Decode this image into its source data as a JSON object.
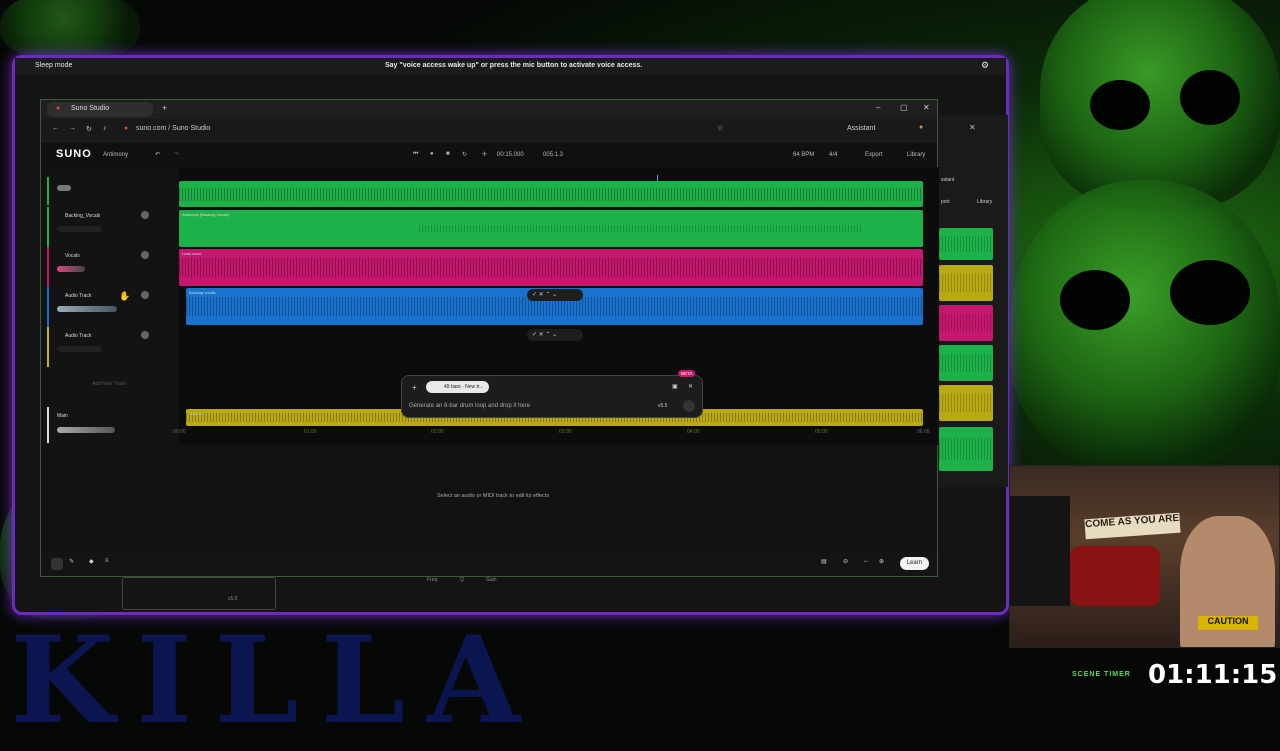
{
  "overlay": {
    "sleep_mode": "Sleep mode",
    "voice_hint": "Say \"voice access wake up\" or press the mic button to activate voice access.",
    "background_text": "KILLA",
    "scene_timer_label": "SCENE TIMER",
    "scene_timer_value": "01:11:15"
  },
  "browser": {
    "tab_title": "Suno Studio",
    "url": "suno.com / Suno Studio",
    "assistant_label": "Assistant"
  },
  "app": {
    "logo": "SUNO",
    "project_name": "Antimony",
    "time": "00:15.000",
    "position": "005.1.3",
    "bpm": "64 BPM",
    "time_signature": "4/4",
    "export_label": "Export",
    "library_label": "Library"
  },
  "tracks": [
    {
      "name": "",
      "color": "#1fb14a"
    },
    {
      "name": "Backing_Vocals",
      "color": "#1fb14a"
    },
    {
      "name": "Vocals",
      "color": "#c0186b"
    },
    {
      "name": "Audio Track",
      "color": "#1f6fc8"
    },
    {
      "name": "Audio Track",
      "color": "#c2b41a"
    }
  ],
  "add_track_label": "Add New Track",
  "main_label": "Main",
  "clips": [
    {
      "label": "",
      "color": "#1db149"
    },
    {
      "label": "Antimony (Backing Vocals)",
      "color": "#1db149"
    },
    {
      "label": "Lead vocal",
      "color": "#c5176d"
    },
    {
      "label": "Backing vocals",
      "color": "#1a72cf"
    },
    {
      "label": "Chorus",
      "color": "#b9aa14"
    }
  ],
  "prompt": {
    "chip_label": "49 bars · New tr...",
    "placeholder": "Generate an 8-bar drum loop and drop it here",
    "version": "v5.5",
    "beta_badge": "BETA"
  },
  "ruler_ticks": [
    "00:00",
    "01:00",
    "02:00",
    "03:00",
    "04:00",
    "05:00",
    "06:08"
  ],
  "effects_hint": "Select an audio or MIDI track to edit its effects",
  "learn_label": "Learn",
  "background_window": {
    "export": "port",
    "library": "Library",
    "assistant": "sstant",
    "eq_labels": [
      "Freq",
      "Q",
      "Gain"
    ],
    "version": "v5.5"
  }
}
